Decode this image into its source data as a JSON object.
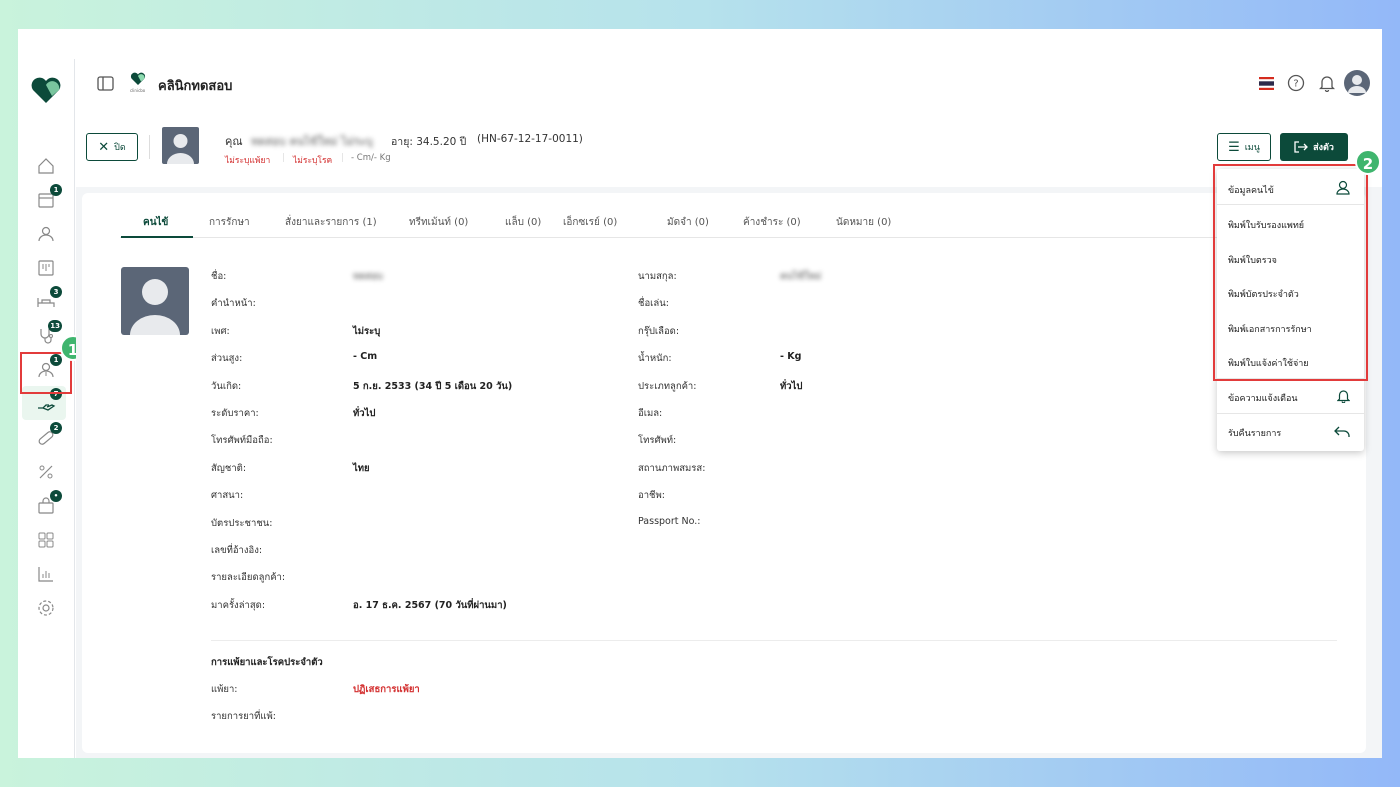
{
  "header": {
    "clinic_name": "คลินิกทดสอบ",
    "logo_caption": "clinicbo"
  },
  "sidebar": {
    "items": [
      {
        "icon": "home-icon",
        "badge": ""
      },
      {
        "icon": "calendar-icon",
        "badge": "1"
      },
      {
        "icon": "user-icon",
        "badge": ""
      },
      {
        "icon": "board-icon",
        "badge": ""
      },
      {
        "icon": "bed-icon",
        "badge": "3"
      },
      {
        "icon": "stethoscope-icon",
        "badge": "13"
      },
      {
        "icon": "doctor-icon",
        "badge": "1"
      },
      {
        "icon": "payment-hand-icon",
        "badge": "7"
      },
      {
        "icon": "pill-icon",
        "badge": "2"
      },
      {
        "icon": "percent-icon",
        "badge": ""
      },
      {
        "icon": "store-icon",
        "badge": "•"
      },
      {
        "icon": "apps-icon",
        "badge": ""
      },
      {
        "icon": "report-chart-icon",
        "badge": ""
      },
      {
        "icon": "settings-icon",
        "badge": ""
      }
    ]
  },
  "steps": {
    "one": "1",
    "two": "2"
  },
  "patient": {
    "close_label": "ปิด",
    "title_prefix": "คุณ",
    "full_name": "ทดสอบ คนไข้ใหม่ ไม่ระบุ",
    "age_text": "อายุ: 34.5.20 ปี",
    "hn": "(HN-67-12-17-0011)",
    "allergy_tag": "ไม่ระบุแพ้ยา",
    "disease_tag": "ไม่ระบุโรค",
    "height_weight": "- Cm/- Kg"
  },
  "actions": {
    "menu_label": "เมนู",
    "send_label": "ส่งตัว"
  },
  "tabs": [
    "คนไข้",
    "การรักษา",
    "สั่งยาและรายการ (1)",
    "ทรีทเม้นท์ (0)",
    "แล็บ (0)",
    "เอ็กซเรย์ (0)",
    "มัดจำ (0)",
    "ค้างชำระ (0)",
    "นัดหมาย (0)"
  ],
  "details_left": [
    {
      "label": "ชื่อ:",
      "value": "ทดสอบ"
    },
    {
      "label": "คำนำหน้า:",
      "value": ""
    },
    {
      "label": "เพศ:",
      "value": "ไม่ระบุ"
    },
    {
      "label": "ส่วนสูง:",
      "value": "- Cm"
    },
    {
      "label": "วันเกิด:",
      "value": "5 ก.ย. 2533 (34 ปี 5 เดือน 20 วัน)"
    },
    {
      "label": "ระดับราคา:",
      "value": "ทั่วไป"
    },
    {
      "label": "โทรศัพท์มือถือ:",
      "value": ""
    },
    {
      "label": "สัญชาติ:",
      "value": "ไทย"
    },
    {
      "label": "ศาสนา:",
      "value": ""
    },
    {
      "label": "บัตรประชาชน:",
      "value": ""
    },
    {
      "label": "เลขที่อ้างอิง:",
      "value": ""
    },
    {
      "label": "รายละเอียดลูกค้า:",
      "value": ""
    },
    {
      "label": "มาครั้งล่าสุด:",
      "value": "อ. 17 ธ.ค. 2567 (70 วันที่ผ่านมา)"
    }
  ],
  "details_right": [
    {
      "label": "นามสกุล:",
      "value": "คนไข้ใหม่"
    },
    {
      "label": "ชื่อเล่น:",
      "value": ""
    },
    {
      "label": "กรุ๊ปเลือด:",
      "value": ""
    },
    {
      "label": "น้ำหนัก:",
      "value": "- Kg"
    },
    {
      "label": "ประเภทลูกค้า:",
      "value": "ทั่วไป"
    },
    {
      "label": "อีเมล:",
      "value": ""
    },
    {
      "label": "โทรศัพท์:",
      "value": ""
    },
    {
      "label": "สถานภาพสมรส:",
      "value": ""
    },
    {
      "label": "อาชีพ:",
      "value": ""
    },
    {
      "label": "Passport No.:",
      "value": ""
    }
  ],
  "allergy_section": {
    "title": "การแพ้ยาและโรคประจำตัว",
    "allergy_label": "แพ้ยา:",
    "allergy_value": "ปฏิเสธการแพ้ยา",
    "drug_list_label": "รายการยาที่แพ้:"
  },
  "dropdown": {
    "items": [
      "ข้อมูลคนไข้",
      "พิมพ์ใบรับรองแพทย์",
      "พิมพ์ใบตรวจ",
      "พิมพ์บัตรประจำตัว",
      "พิมพ์เอกสารการรักษา",
      "พิมพ์ใบแจ้งค่าใช้จ่าย",
      "ข้อความแจ้งเตือน",
      "รับคืนรายการ"
    ]
  },
  "colors": {
    "brand": "#0c4a3a",
    "accent_green": "#3fb56e",
    "highlight_red": "#e23b3b",
    "danger_text": "#d32f2f"
  }
}
